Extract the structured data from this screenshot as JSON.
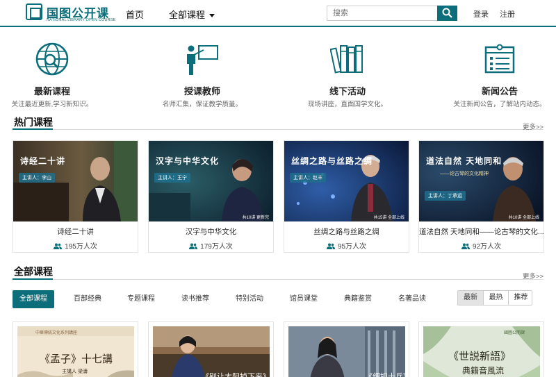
{
  "header": {
    "logo_cn": "国图公开课",
    "logo_en": "NATIONAL LIBRARY OPEN COURSE",
    "nav_home": "首页",
    "nav_all": "全部课程",
    "search_placeholder": "搜索",
    "login": "登录",
    "register": "注册",
    "accent_color": "#0b6e7a"
  },
  "features": [
    {
      "icon": "globe-search-icon",
      "title": "最新课程",
      "desc": "关注最近更新,学习新知识。"
    },
    {
      "icon": "teacher-board-icon",
      "title": "授课教师",
      "desc": "名师汇集，保证教学质量。"
    },
    {
      "icon": "books-icon",
      "title": "线下活动",
      "desc": "现场讲座，直面国学文化。"
    },
    {
      "icon": "calendar-news-icon",
      "title": "新闻公告",
      "desc": "关注新闻公告，了解站内动态。"
    }
  ],
  "hot": {
    "title": "热门课程",
    "more": "更多>>",
    "cards": [
      {
        "thumb_title": "诗经二十讲",
        "lecturer": "主讲人：李山",
        "episodes": "",
        "title": "诗经二十讲",
        "views": "195万人次"
      },
      {
        "thumb_title": "汉字与中华文化",
        "lecturer": "主讲人：王宁",
        "episodes": "共10讲  更新完",
        "title": "汉字与中华文化",
        "views": "179万人次"
      },
      {
        "thumb_title": "丝绸之路与丝路之绸",
        "lecturer": "主讲人：赵丰",
        "episodes": "共15讲  全部上线",
        "title": "丝绸之路与丝路之绸",
        "views": "95万人次"
      },
      {
        "thumb_title": "道法自然  天地同和",
        "subtitle": "——论古琴的文化精神",
        "lecturer": "主讲人：丁承运",
        "episodes": "共10讲  全部上线",
        "title": "道法自然 天地同和——论古琴的文化...",
        "views": "92万人次"
      }
    ]
  },
  "all": {
    "title": "全部课程",
    "more": "更多>>",
    "tabs": [
      "全部课程",
      "百部经典",
      "专题课程",
      "读书推荐",
      "特别活动",
      "馆员课堂",
      "典籍鉴赏",
      "名著品读"
    ],
    "sort": [
      "最新",
      "最热",
      "推荐"
    ],
    "cards": [
      {
        "text": "《孟子》十七講",
        "sub": "主講人  梁濤",
        "top": "中華傳統文化系列講座"
      },
      {
        "text": "《别让太阳掉下来》"
      },
      {
        "text": "《细扣十兵》"
      },
      {
        "text": "《世説新語》",
        "sub": "典籍音風流",
        "top": "國圖公開課"
      }
    ]
  }
}
